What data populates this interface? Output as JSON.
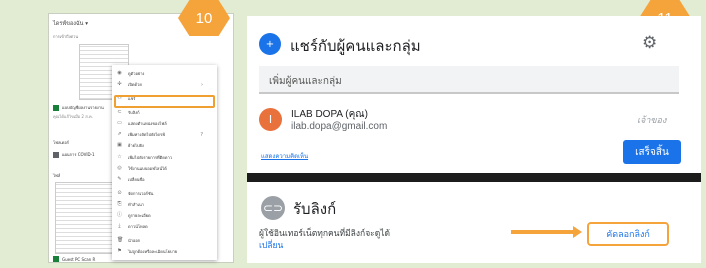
{
  "steps": {
    "left": "10",
    "right": "11"
  },
  "drive": {
    "header": "ไดรฟ์ของฉัน ▾",
    "subheader": "การเข้าถึงด่วน",
    "file_selected": "แบบบัญชีผลงานรายงาน",
    "file_selected_sub": "คุณได้แก้ไขเมื่อ 2 ส.ค.",
    "folders_label": "โฟลเดอร์",
    "folder_item": "แผนการ COVID-1",
    "files_label": "ไฟล์",
    "bottom_file": "Guest PC Scan R",
    "menu": [
      {
        "icon": "eye-icon",
        "glyph": "◉",
        "label": "ดูตัวอย่าง",
        "arrow": ""
      },
      {
        "icon": "open-with-icon",
        "glyph": "✣",
        "label": "เปิดด้วย",
        "arrow": "›"
      },
      {
        "icon": "share-icon",
        "glyph": "⚇",
        "label": "แชร์",
        "arrow": ""
      },
      {
        "icon": "link-icon",
        "glyph": "⊂",
        "label": "รับลิงก์",
        "arrow": ""
      },
      {
        "icon": "folder-icon",
        "glyph": "▭",
        "label": "แสดงตำแหน่งของไฟล์",
        "arrow": ""
      },
      {
        "icon": "shortcut-icon",
        "glyph": "⇗",
        "label": "เพิ่มทางลัดไปยังไดรฟ์",
        "arrow": "?"
      },
      {
        "icon": "move-icon",
        "glyph": "▣",
        "label": "ย้ายไปยัง",
        "arrow": ""
      },
      {
        "icon": "star-icon",
        "glyph": "☆",
        "label": "เพิ่มไปยังรายการที่ติดดาว",
        "arrow": ""
      },
      {
        "icon": "offline-icon",
        "glyph": "◎",
        "label": "ใช้งานแบบออฟไลน์ได้",
        "arrow": ""
      },
      {
        "icon": "rename-icon",
        "glyph": "✎",
        "label": "เปลี่ยนชื่อ",
        "arrow": ""
      },
      {
        "icon": "versions-icon",
        "glyph": "⊙",
        "label": "จัดการเวอร์ชัน",
        "arrow": ""
      },
      {
        "icon": "copy-icon",
        "glyph": "⎘",
        "label": "ทำสำเนา",
        "arrow": ""
      },
      {
        "icon": "info-icon",
        "glyph": "ⓘ",
        "label": "ดูรายละเอียด",
        "arrow": ""
      },
      {
        "icon": "download-icon",
        "glyph": "⤓",
        "label": "ดาวน์โหลด",
        "arrow": ""
      },
      {
        "icon": "trash-icon",
        "glyph": "🗑",
        "label": "นำออก",
        "arrow": ""
      },
      {
        "icon": "report-icon",
        "glyph": "⚑",
        "label": "ไม่ถูกต้องหรือละเมิดนโยบาย",
        "arrow": ""
      }
    ]
  },
  "share_dialog": {
    "title": "แชร์กับผู้คนและกลุ่ม",
    "add_placeholder": "เพิ่มผู้คนและกลุ่ม",
    "user_initial": "I",
    "user_name": "ILAB DOPA (คุณ)",
    "user_email": "ilab.dopa@gmail.com",
    "user_role": "เจ้าของ",
    "feedback_link": "แสดงความคิดเห็น",
    "done_button": "เสร็จสิ้น"
  },
  "get_link": {
    "title": "รับลิงก์",
    "description": "ผู้ใช้อินเทอร์เน็ตทุกคนที่มีลิงก์จะดูได้",
    "change_link": "เปลี่ยน",
    "copy_button": "คัดลอกลิงก์"
  },
  "colors": {
    "accent_orange": "#f5a33b",
    "google_blue": "#1a73e8",
    "background": "#e2ecd2"
  }
}
